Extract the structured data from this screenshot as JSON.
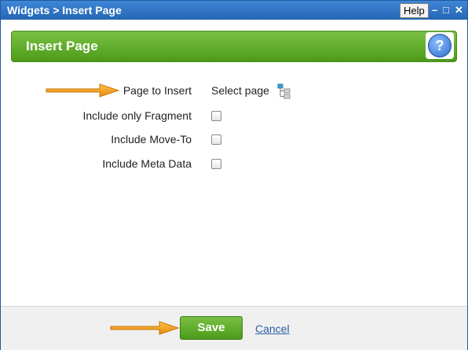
{
  "window": {
    "title": "Widgets > Insert Page",
    "help_label": "Help",
    "minimize_glyph": "–",
    "maximize_glyph": "□",
    "close_glyph": "✕"
  },
  "header": {
    "title": "Insert Page",
    "help_icon": "question-mark-icon",
    "help_glyph": "?"
  },
  "form": {
    "page_to_insert": {
      "label": "Page to Insert",
      "value": "Select page",
      "icon": "page-tree-icon"
    },
    "include_only_fragment": {
      "label": "Include only Fragment",
      "checked": false
    },
    "include_move_to": {
      "label": "Include Move-To",
      "checked": false
    },
    "include_meta_data": {
      "label": "Include Meta Data",
      "checked": false
    }
  },
  "footer": {
    "save_label": "Save",
    "cancel_label": "Cancel"
  },
  "colors": {
    "titlebar": "#2466b4",
    "accent_green": "#5aa823",
    "arrow_orange": "#f39c12",
    "link_blue": "#2b5ea8"
  }
}
